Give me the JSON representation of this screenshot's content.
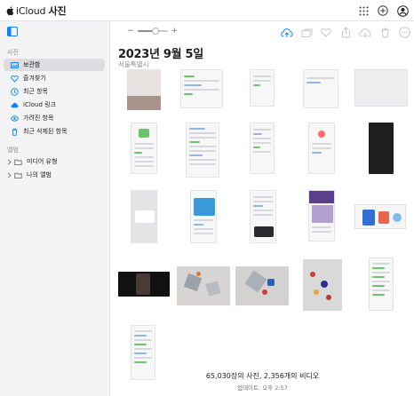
{
  "app": {
    "brand": "iCloud",
    "title": "사진"
  },
  "topbar": {
    "icons": [
      "apps-grid-icon",
      "add-circle-icon",
      "account-icon"
    ]
  },
  "sidebar": {
    "section_photos": "사진",
    "items": [
      {
        "label": "보관함",
        "icon": "library-icon",
        "active": true
      },
      {
        "label": "즐겨찾기",
        "icon": "heart-icon"
      },
      {
        "label": "최근 항목",
        "icon": "clock-icon"
      },
      {
        "label": "iCloud 링크",
        "icon": "cloud-link-icon"
      },
      {
        "label": "가려진 항목",
        "icon": "eye-icon"
      },
      {
        "label": "최근 삭제된 항목",
        "icon": "trash-icon"
      }
    ],
    "section_albums": "앨범",
    "groups": [
      {
        "label": "미디어 유형",
        "icon": "folder-icon"
      },
      {
        "label": "나의 앨범",
        "icon": "folder-icon"
      }
    ]
  },
  "zoom": {
    "minus": "−",
    "plus": "+",
    "level": 0.6
  },
  "toolbar": {
    "icons": [
      "upload-icon",
      "add-to-album-icon",
      "favorite-icon",
      "share-icon",
      "download-icon",
      "delete-icon",
      "more-icon"
    ]
  },
  "main": {
    "date_title": "2023년 9월 5일",
    "location": "서울특별시"
  },
  "footer": {
    "count": "65,030장의 사진, 2,356개의 비디오",
    "updated": "업데이트: 오후 2:57"
  },
  "colors": {
    "accent": "#0a84ff",
    "sidebar_bg": "#f4f4f6",
    "active_item": "#dcdce1"
  }
}
